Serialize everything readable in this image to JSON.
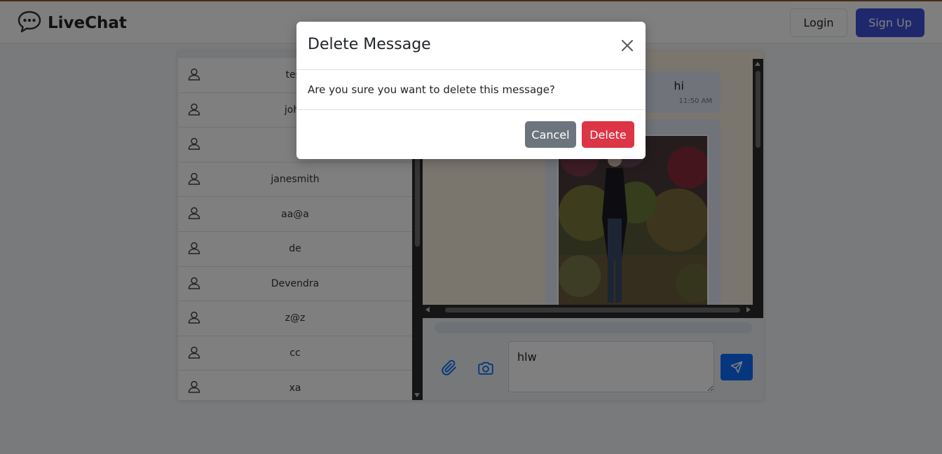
{
  "navbar": {
    "brand": "LiveChat",
    "login_label": "Login",
    "signup_label": "Sign Up",
    "brand_icon": "chat-bubble-icon"
  },
  "users": [
    {
      "name": "test"
    },
    {
      "name": "john"
    },
    {
      "name": ""
    },
    {
      "name": "janesmith"
    },
    {
      "name": "aa@a"
    },
    {
      "name": "de"
    },
    {
      "name": "Devendra"
    },
    {
      "name": "z@z"
    },
    {
      "name": "cc"
    },
    {
      "name": "xa"
    }
  ],
  "chat": {
    "messages": [
      {
        "text": "hi",
        "time": "11:50 AM"
      }
    ],
    "input_value": "hlw",
    "attach_icon": "paperclip-icon",
    "camera_icon": "camera-icon",
    "send_icon": "send-icon"
  },
  "modal": {
    "title": "Delete Message",
    "body": "Are you sure you want to delete this message?",
    "cancel_label": "Cancel",
    "delete_label": "Delete"
  },
  "colors": {
    "primary": "#3f51d9",
    "send": "#0d6efd",
    "danger": "#dc3545",
    "secondary": "#6c757d"
  }
}
